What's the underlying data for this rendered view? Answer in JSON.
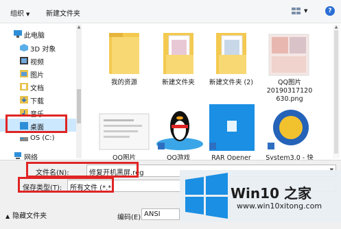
{
  "toolbar": {
    "organize_label": "组织",
    "new_folder_label": "新建文件夹",
    "help_label": "?"
  },
  "sidebar": {
    "items": [
      {
        "label": "此电脑",
        "icon": "computer-icon"
      },
      {
        "label": "3D 对象",
        "icon": "3d-objects-icon"
      },
      {
        "label": "视频",
        "icon": "video-folder-icon"
      },
      {
        "label": "图片",
        "icon": "pictures-folder-icon"
      },
      {
        "label": "文档",
        "icon": "documents-folder-icon"
      },
      {
        "label": "下载",
        "icon": "downloads-folder-icon"
      },
      {
        "label": "音乐",
        "icon": "music-folder-icon"
      },
      {
        "label": "桌面",
        "icon": "desktop-folder-icon"
      },
      {
        "label": "OS (C:)",
        "icon": "drive-icon"
      },
      {
        "label": "网络",
        "icon": "network-icon"
      }
    ],
    "selected": "桌面"
  },
  "files": [
    {
      "caption": "我的资源",
      "type": "folder"
    },
    {
      "caption": "新建文件夹",
      "type": "folder"
    },
    {
      "caption": "新建文件夹 (2)",
      "type": "folder"
    },
    {
      "caption": "QQ图片\n20190317120\n630.png",
      "type": "image"
    },
    {
      "caption": "QQ图片",
      "type": "image"
    },
    {
      "caption": "QQ游戏",
      "type": "shortcut"
    },
    {
      "caption": "RAR Opener",
      "type": "shortcut"
    },
    {
      "caption": "System3.0 - 快",
      "type": "shortcut"
    }
  ],
  "save": {
    "filename_label": "文件名(N):",
    "filename_value": "修复开机黑屏.reg",
    "filetype_label": "保存类型(T):",
    "filetype_value": "所有文件  (*.*)",
    "encoding_label": "编码(E):",
    "encoding_value": "ANSI",
    "hide_folders_label": "隐藏文件夹"
  },
  "watermark": {
    "title": "Win10 之家",
    "url": "www.win10xitong.com"
  },
  "colors": {
    "highlight_red": "#e02424",
    "selection": "#cce8ff",
    "folder_yellow": "#f3c94f",
    "win_blue": "#1a8fe3"
  }
}
